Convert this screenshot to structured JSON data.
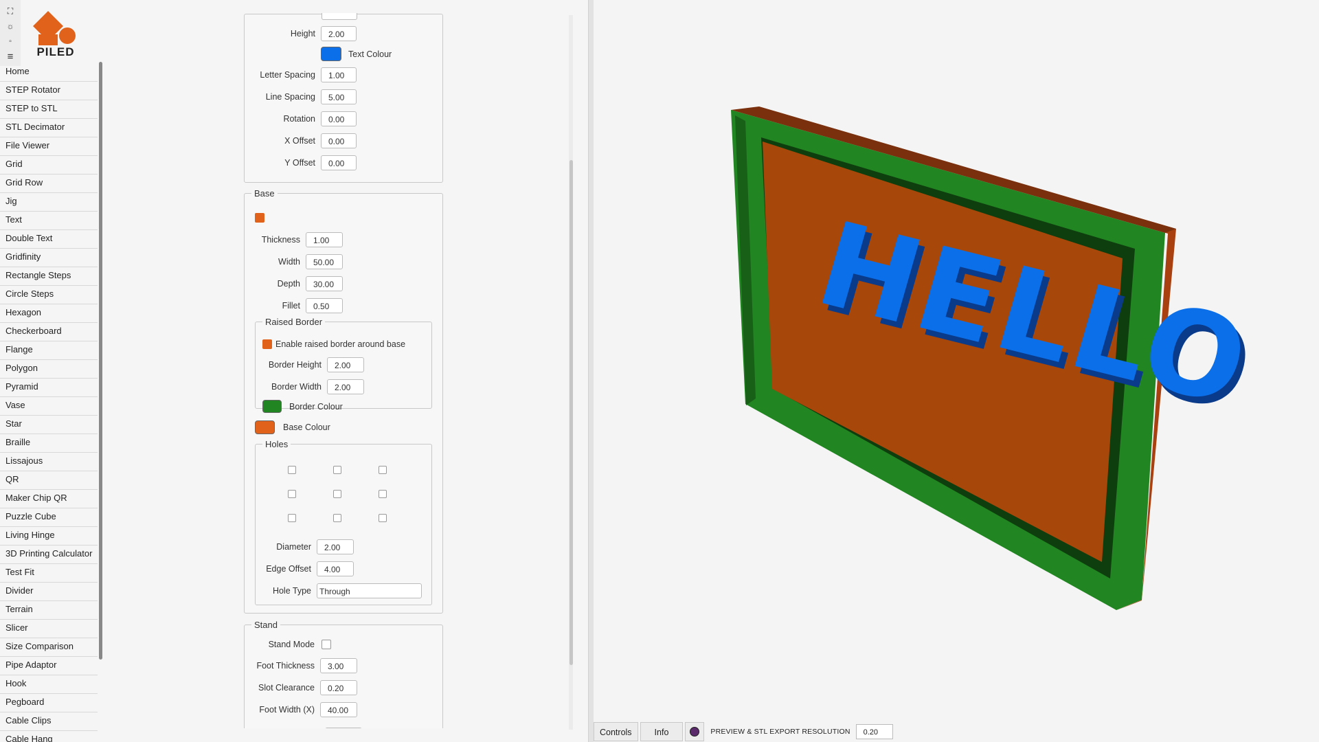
{
  "app": {
    "logo_text": "PILED"
  },
  "toolbar": {
    "icons": [
      "expand-icon",
      "sun-icon",
      "window-icon",
      "menu-icon"
    ]
  },
  "sidebar": {
    "items": [
      {
        "label": "Home"
      },
      {
        "label": "STEP Rotator"
      },
      {
        "label": "STEP to STL"
      },
      {
        "label": "STL Decimator"
      },
      {
        "label": "File Viewer"
      },
      {
        "label": "Grid"
      },
      {
        "label": "Grid Row"
      },
      {
        "label": "Jig"
      },
      {
        "label": "Text"
      },
      {
        "label": "Double Text"
      },
      {
        "label": "Gridfinity"
      },
      {
        "label": "Rectangle Steps"
      },
      {
        "label": "Circle Steps"
      },
      {
        "label": "Hexagon"
      },
      {
        "label": "Checkerboard"
      },
      {
        "label": "Flange"
      },
      {
        "label": "Polygon"
      },
      {
        "label": "Pyramid"
      },
      {
        "label": "Vase"
      },
      {
        "label": "Star"
      },
      {
        "label": "Braille"
      },
      {
        "label": "Lissajous"
      },
      {
        "label": "QR"
      },
      {
        "label": "Maker Chip QR"
      },
      {
        "label": "Puzzle Cube"
      },
      {
        "label": "Living Hinge"
      },
      {
        "label": "3D Printing Calculator"
      },
      {
        "label": "Test Fit"
      },
      {
        "label": "Divider"
      },
      {
        "label": "Terrain"
      },
      {
        "label": "Slicer"
      },
      {
        "label": "Size Comparison"
      },
      {
        "label": "Pipe Adaptor"
      },
      {
        "label": "Hook"
      },
      {
        "label": "Pegboard"
      },
      {
        "label": "Cable Clips"
      },
      {
        "label": "Cable Hang"
      }
    ]
  },
  "text_section": {
    "height_label": "Height",
    "height": "2.00",
    "text_colour_label": "Text Colour",
    "text_colour": "#0a6fe8",
    "letter_spacing_label": "Letter Spacing",
    "letter_spacing": "1.00",
    "line_spacing_label": "Line Spacing",
    "line_spacing": "5.00",
    "rotation_label": "Rotation",
    "rotation": "0.00",
    "x_offset_label": "X Offset",
    "x_offset": "0.00",
    "y_offset_label": "Y Offset",
    "y_offset": "0.00"
  },
  "base": {
    "legend": "Base",
    "thickness_label": "Thickness",
    "thickness": "1.00",
    "width_label": "Width",
    "width": "50.00",
    "depth_label": "Depth",
    "depth": "30.00",
    "fillet_label": "Fillet",
    "fillet": "0.50",
    "raised_border": {
      "legend": "Raised Border",
      "enable_label": "Enable raised border around base",
      "border_height_label": "Border Height",
      "border_height": "2.00",
      "border_width_label": "Border Width",
      "border_width": "2.00",
      "border_colour_label": "Border Colour",
      "border_colour": "#218521"
    },
    "base_colour_label": "Base Colour",
    "base_colour": "#e0621b",
    "holes": {
      "legend": "Holes",
      "diameter_label": "Diameter",
      "diameter": "2.00",
      "edge_offset_label": "Edge Offset",
      "edge_offset": "4.00",
      "hole_type_label": "Hole Type",
      "hole_type": "Through"
    }
  },
  "stand": {
    "legend": "Stand",
    "stand_mode_label": "Stand Mode",
    "foot_thickness_label": "Foot Thickness",
    "foot_thickness": "3.00",
    "slot_clearance_label": "Slot Clearance",
    "slot_clearance": "0.20",
    "foot_width_label": "Foot Width (X)",
    "foot_width": "40.00"
  },
  "model": {
    "text": "HELLO"
  },
  "status_bar": {
    "controls_label": "Controls",
    "info_label": "Info",
    "resolution_label": "PREVIEW & STL EXPORT RESOLUTION",
    "resolution": "0.20"
  }
}
